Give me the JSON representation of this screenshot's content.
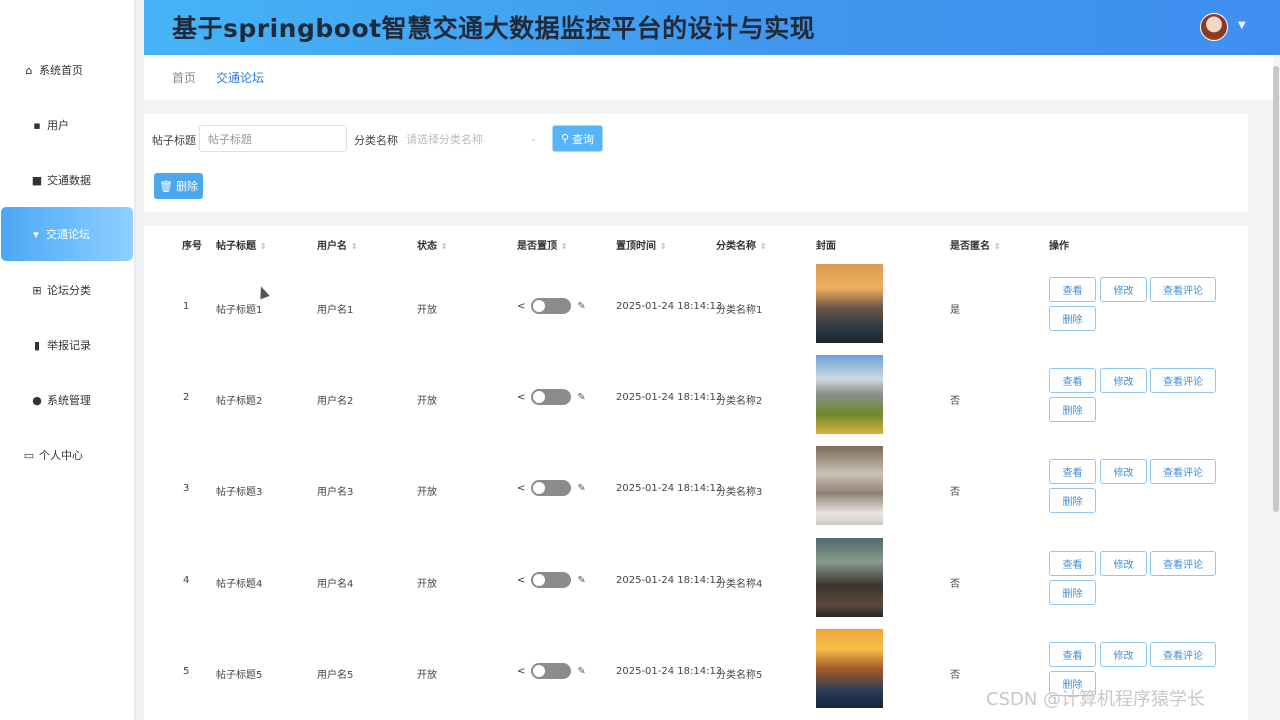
{
  "app": {
    "title": "基于springboot智慧交通大数据监控平台的设计与实现"
  },
  "sidebar": {
    "items": [
      {
        "label": "系统首页",
        "icon": "home-icon"
      },
      {
        "label": "用户",
        "icon": "user-icon"
      },
      {
        "label": "交通数据",
        "icon": "briefcase-icon"
      },
      {
        "label": "交通论坛",
        "icon": "chat-icon",
        "active": true
      },
      {
        "label": "论坛分类",
        "icon": "grid-icon"
      },
      {
        "label": "举报记录",
        "icon": "book-icon"
      },
      {
        "label": "系统管理",
        "icon": "person-icon"
      },
      {
        "label": "个人中心",
        "icon": "calendar-icon"
      }
    ]
  },
  "breadcrumb": {
    "home": "首页",
    "current": "交通论坛"
  },
  "search": {
    "title_label": "帖子标题",
    "title_placeholder": "帖子标题",
    "category_label": "分类名称",
    "category_placeholder": "请选择分类名称",
    "query_label": "查询",
    "delete_label": "删除"
  },
  "table": {
    "headers": {
      "index": "序号",
      "title": "帖子标题",
      "username": "用户名",
      "status": "状态",
      "pinned": "是否置顶",
      "pin_time": "置顶时间",
      "category": "分类名称",
      "cover": "封面",
      "anonymous": "是否匿名",
      "actions": "操作"
    },
    "actions": {
      "view": "查看",
      "edit": "修改",
      "comments": "查看评论",
      "delete": "删除"
    },
    "rows": [
      {
        "index": "1",
        "title": "帖子标题1",
        "username": "用户名1",
        "status": "开放",
        "pin_time": "2025-01-24 18:14:13",
        "category": "分类名称1",
        "anonymous": "是",
        "cover": "sunset-boats"
      },
      {
        "index": "2",
        "title": "帖子标题2",
        "username": "用户名2",
        "status": "开放",
        "pin_time": "2025-01-24 18:14:13",
        "category": "分类名称2",
        "anonymous": "否",
        "cover": "mountains"
      },
      {
        "index": "3",
        "title": "帖子标题3",
        "username": "用户名3",
        "status": "开放",
        "pin_time": "2025-01-24 18:14:13",
        "category": "分类名称3",
        "anonymous": "否",
        "cover": "library"
      },
      {
        "index": "4",
        "title": "帖子标题4",
        "username": "用户名4",
        "status": "开放",
        "pin_time": "2025-01-24 18:14:13",
        "category": "分类名称4",
        "anonymous": "否",
        "cover": "people"
      },
      {
        "index": "5",
        "title": "帖子标题5",
        "username": "用户名5",
        "status": "开放",
        "pin_time": "2025-01-24 18:14:13",
        "category": "分类名称5",
        "anonymous": "否",
        "cover": "sunset-sea"
      }
    ]
  },
  "watermark": "CSDN @计算机程序猿学长"
}
